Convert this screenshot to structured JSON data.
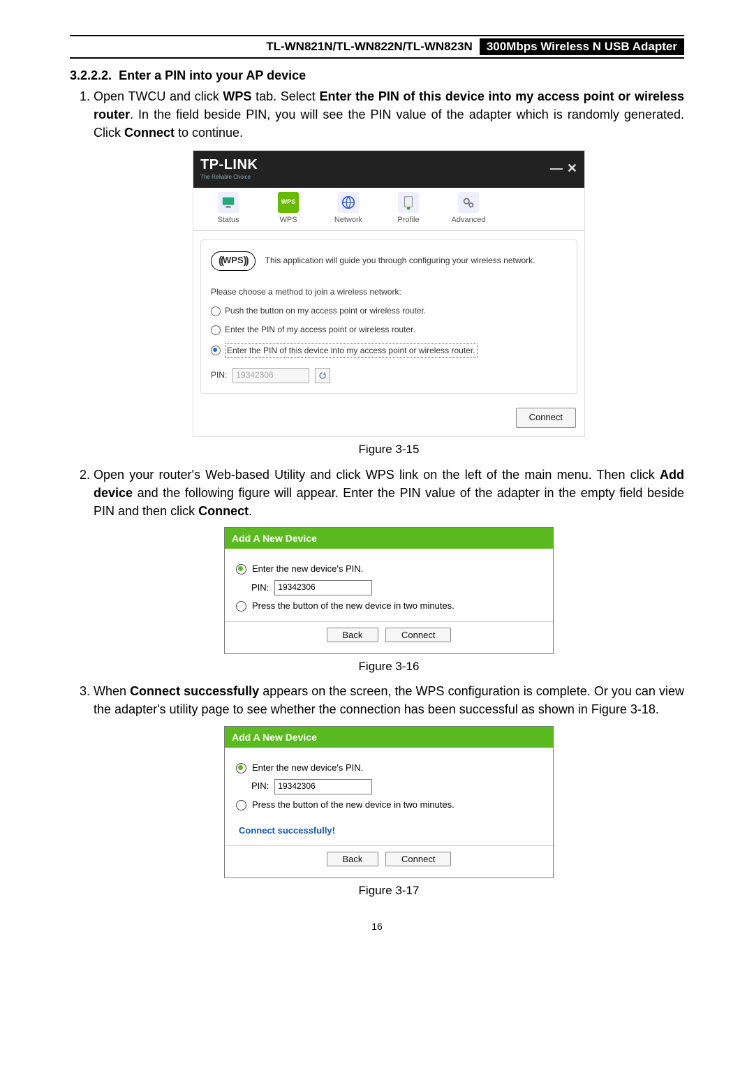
{
  "header": {
    "model": "TL-WN821N/TL-WN822N/TL-WN823N",
    "product": "300Mbps Wireless N USB Adapter"
  },
  "section": {
    "number": "3.2.2.2.",
    "title": "Enter a PIN into your AP device"
  },
  "steps": {
    "s1": {
      "pre": "Open TWCU and click ",
      "b1": "WPS",
      "mid1": " tab. Select ",
      "b2": "Enter the PIN of this device into my access point or wireless router",
      "mid2": ". In the field beside PIN, you will see the PIN value of the adapter which is randomly generated. Click ",
      "b3": "Connect",
      "post": " to continue."
    },
    "s2": {
      "pre": "Open your router's Web-based Utility and click WPS link on the left of the main menu. Then click ",
      "b1": "Add device",
      "mid1": " and the following figure will appear. Enter the PIN value of the adapter in the empty field beside PIN and then click ",
      "b2": "Connect",
      "post": "."
    },
    "s3": {
      "pre": "When ",
      "b1": "Connect successfully",
      "post": " appears on the screen, the WPS configuration is complete. Or you can view the adapter's utility page to see whether the connection has been successful as shown in Figure 3-18."
    }
  },
  "captions": {
    "fig15": "Figure 3-15",
    "fig16": "Figure 3-16",
    "fig17": "Figure 3-17"
  },
  "twcu": {
    "brand": "TP-LINK",
    "tagline": "The Reliable Choice",
    "tabs": {
      "status": "Status",
      "wps": "WPS",
      "network": "Network",
      "profile": "Profile",
      "advanced": "Advanced"
    },
    "intro": "This application will guide you through configuring your wireless network.",
    "wpsChip": "WPS",
    "choose": "Please choose a method to join a wireless network:",
    "opt1": "Push the button on my access point or wireless router.",
    "opt2": "Enter the PIN of my access point or wireless router.",
    "opt3": "Enter the PIN of this device into my access point or wireless router.",
    "pinLabel": "PIN:",
    "pinValue": "19342306",
    "connect": "Connect"
  },
  "router": {
    "title": "Add A New Device",
    "opt1": "Enter the new device's PIN.",
    "pinLabel": "PIN:",
    "pinValue": "19342306",
    "opt2": "Press the button of the new device in two minutes.",
    "back": "Back",
    "connect": "Connect",
    "success": "Connect successfully!"
  },
  "pageNumber": "16"
}
